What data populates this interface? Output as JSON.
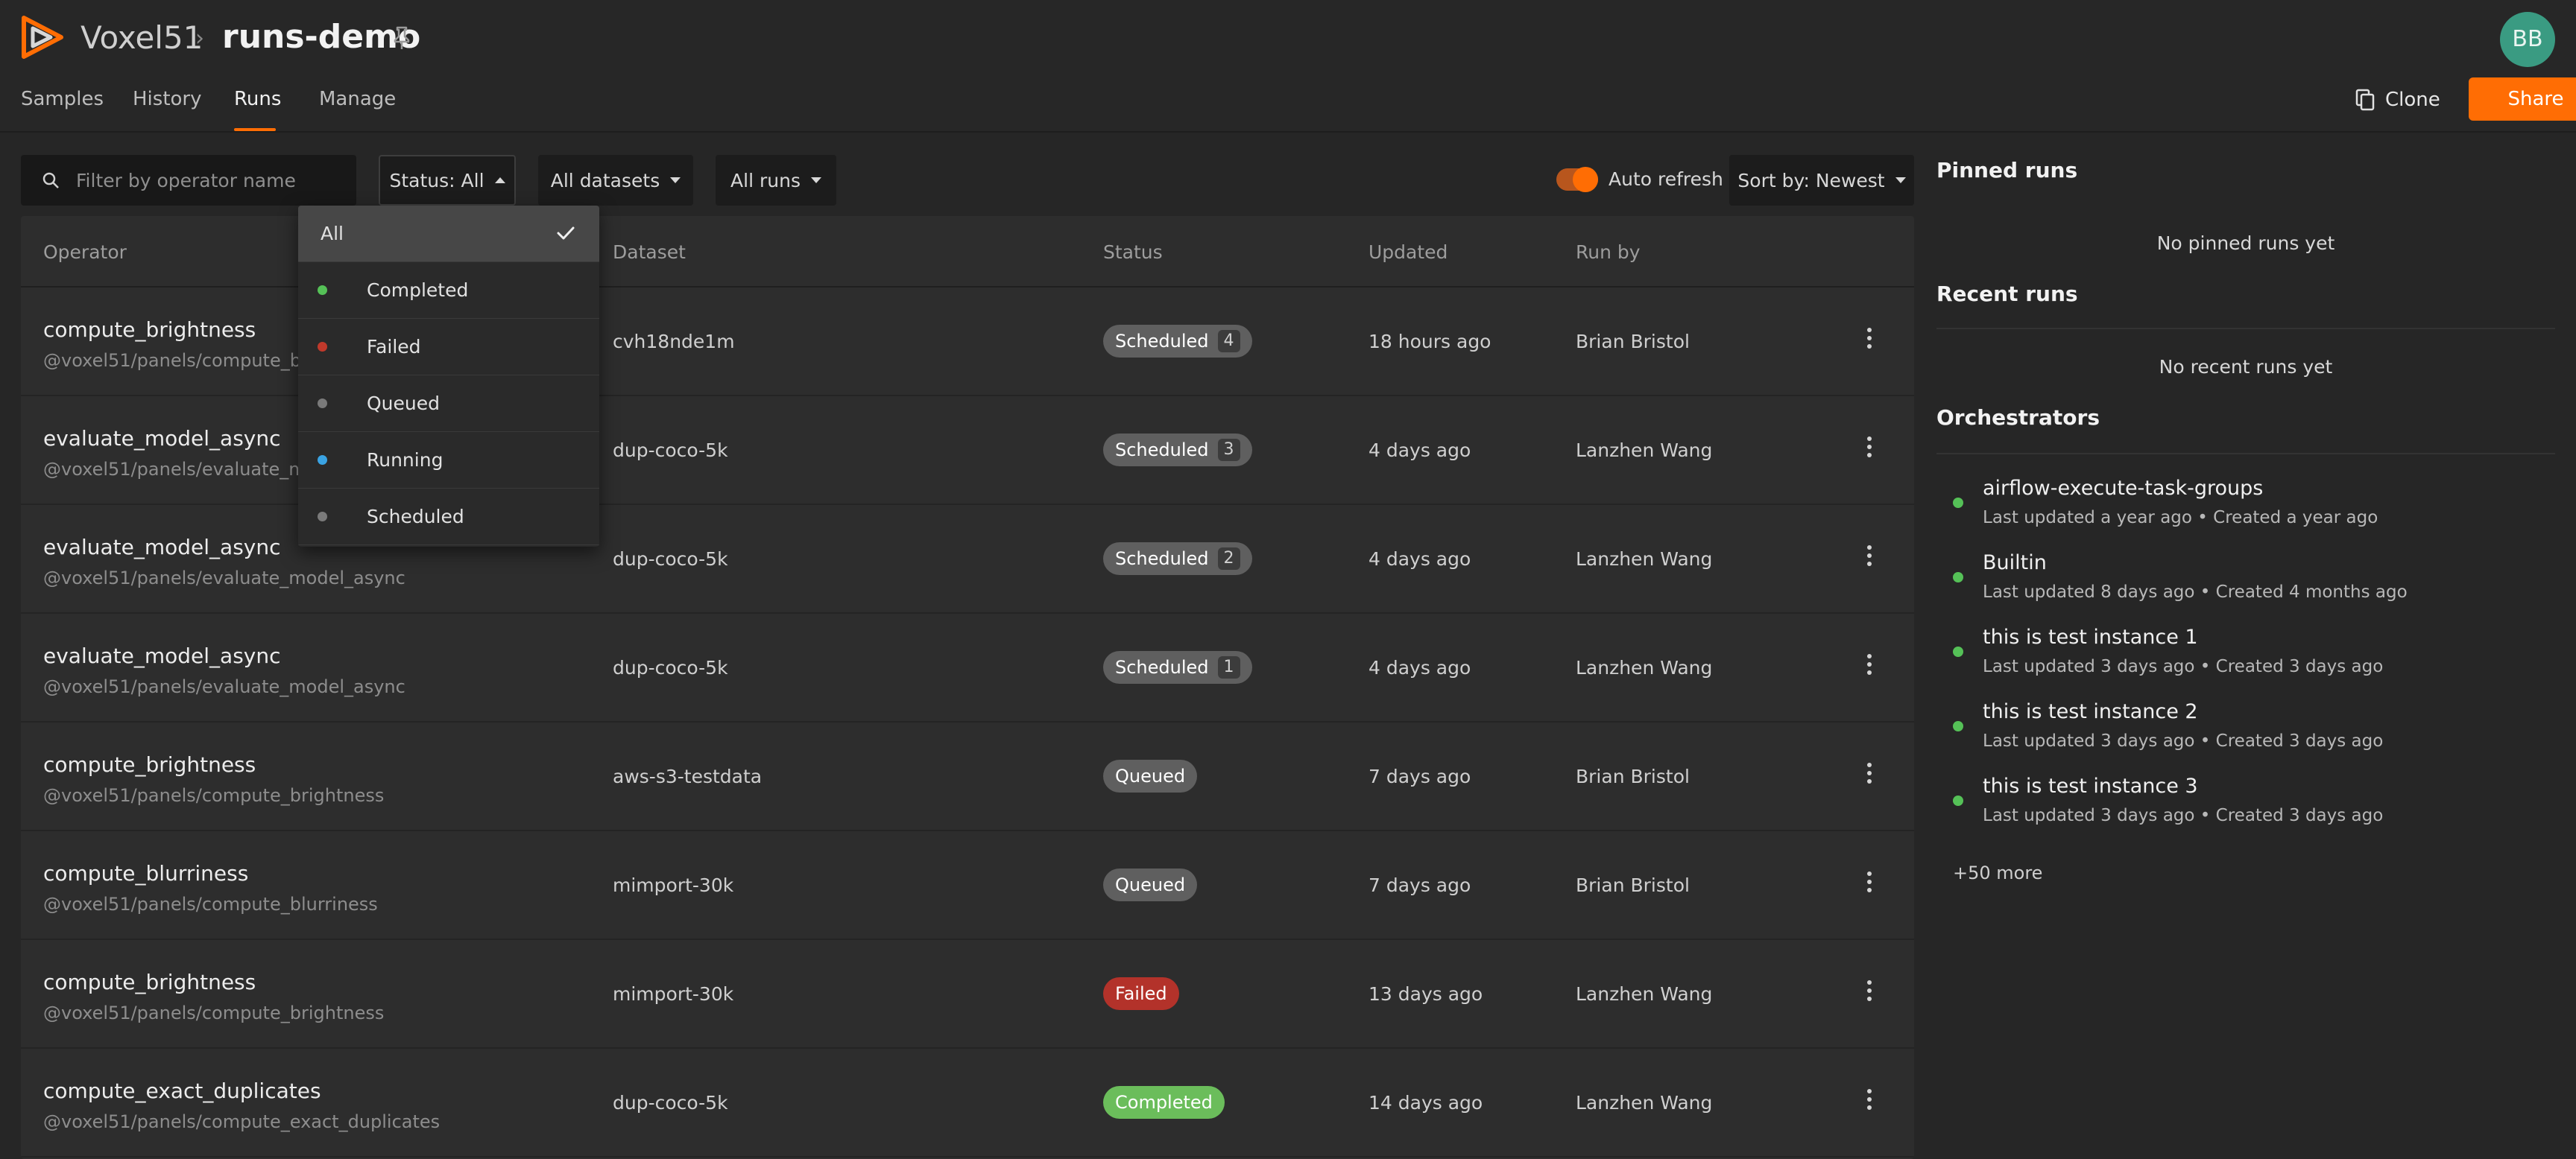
{
  "header": {
    "brand": "Voxel51",
    "dataset": "runs-demo",
    "avatar_initials": "BB",
    "tabs": [
      {
        "label": "Samples"
      },
      {
        "label": "History"
      },
      {
        "label": "Runs"
      },
      {
        "label": "Manage"
      }
    ],
    "active_tab": "Runs",
    "clone_label": "Clone",
    "share_label": "Share"
  },
  "toolbar": {
    "filter_placeholder": "Filter by operator name",
    "status_label": "Status: All",
    "datasets_label": "All datasets",
    "runs_label": "All runs",
    "auto_refresh_label": "Auto refresh",
    "auto_refresh_on": true,
    "sort_label": "Sort by: Newest"
  },
  "status_dropdown": {
    "items": [
      {
        "label": "All",
        "selected": true
      },
      {
        "label": "Completed",
        "dot": "#55c157"
      },
      {
        "label": "Failed",
        "dot": "#c0392b"
      },
      {
        "label": "Queued",
        "dot": "#7a7a7a"
      },
      {
        "label": "Running",
        "dot": "#3aa3e3"
      },
      {
        "label": "Scheduled",
        "dot": "#7a7a7a"
      }
    ]
  },
  "table": {
    "columns": [
      "Operator",
      "Dataset",
      "Status",
      "Updated",
      "Run by"
    ],
    "rows": [
      {
        "operator": "compute_brightness",
        "path": "@voxel51/panels/compute_brig",
        "dataset": "cvh18nde1m",
        "status": "Scheduled",
        "count": "4",
        "updated": "18 hours ago",
        "run_by": "Brian Bristol"
      },
      {
        "operator": "evaluate_model_async",
        "path": "@voxel51/panels/evaluate_mod",
        "dataset": "dup-coco-5k",
        "status": "Scheduled",
        "count": "3",
        "updated": "4 days ago",
        "run_by": "Lanzhen Wang"
      },
      {
        "operator": "evaluate_model_async",
        "path": "@voxel51/panels/evaluate_model_async",
        "dataset": "dup-coco-5k",
        "status": "Scheduled",
        "count": "2",
        "updated": "4 days ago",
        "run_by": "Lanzhen Wang"
      },
      {
        "operator": "evaluate_model_async",
        "path": "@voxel51/panels/evaluate_model_async",
        "dataset": "dup-coco-5k",
        "status": "Scheduled",
        "count": "1",
        "updated": "4 days ago",
        "run_by": "Lanzhen Wang"
      },
      {
        "operator": "compute_brightness",
        "path": "@voxel51/panels/compute_brightness",
        "dataset": "aws-s3-testdata",
        "status": "Queued",
        "count": "",
        "updated": "7 days ago",
        "run_by": "Brian Bristol"
      },
      {
        "operator": "compute_blurriness",
        "path": "@voxel51/panels/compute_blurriness",
        "dataset": "mimport-30k",
        "status": "Queued",
        "count": "",
        "updated": "7 days ago",
        "run_by": "Brian Bristol"
      },
      {
        "operator": "compute_brightness",
        "path": "@voxel51/panels/compute_brightness",
        "dataset": "mimport-30k",
        "status": "Failed",
        "count": "",
        "updated": "13 days ago",
        "run_by": "Lanzhen Wang"
      },
      {
        "operator": "compute_exact_duplicates",
        "path": "@voxel51/panels/compute_exact_duplicates",
        "dataset": "dup-coco-5k",
        "status": "Completed",
        "count": "",
        "updated": "14 days ago",
        "run_by": "Lanzhen Wang"
      }
    ]
  },
  "right_panel": {
    "pinned_title": "Pinned runs",
    "pinned_empty": "No pinned runs yet",
    "recent_title": "Recent runs",
    "recent_empty": "No recent runs yet",
    "orchestrators_title": "Orchestrators",
    "orchestrators": [
      {
        "name": "airflow-execute-task-groups",
        "meta": "Last updated a year ago  •  Created a year ago"
      },
      {
        "name": "Builtin",
        "meta": "Last updated 8 days ago  •  Created 4 months ago"
      },
      {
        "name": "this is test instance 1",
        "meta": "Last updated 3 days ago  •  Created 3 days ago"
      },
      {
        "name": "this is test instance 2",
        "meta": "Last updated 3 days ago  •  Created 3 days ago"
      },
      {
        "name": "this is test instance 3",
        "meta": "Last updated 3 days ago  •  Created 3 days ago"
      }
    ],
    "more_label": "+50 more"
  },
  "colors": {
    "accent": "#ff6d04",
    "background": "#262626",
    "status_failed": "#b3322a",
    "status_completed": "#6bbd5b",
    "status_neutral": "#5f5f5f"
  }
}
